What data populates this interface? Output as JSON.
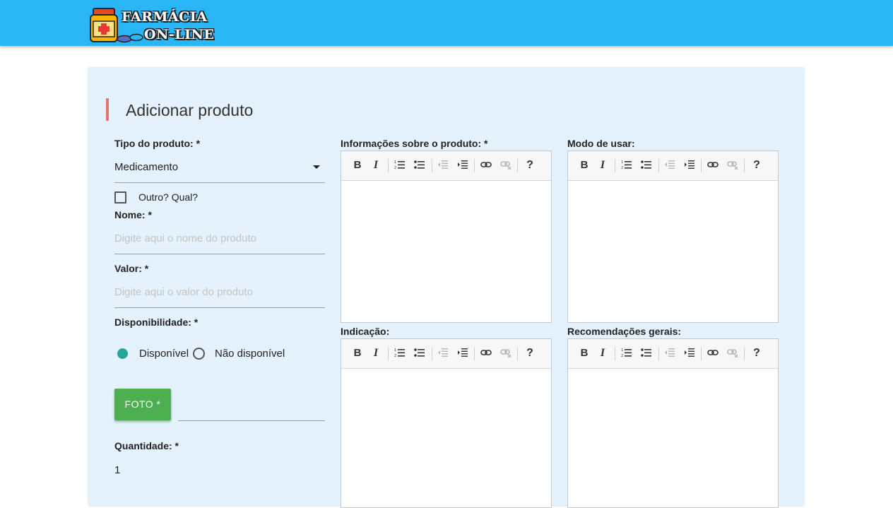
{
  "navbar": {
    "logo_line1": "FARMÁCIA",
    "logo_line2": "ON-LINE",
    "color": "#29b6f6"
  },
  "form": {
    "title": "Adicionar produto",
    "tipo": {
      "label": "Tipo do produto: *",
      "value": "Medicamento"
    },
    "outro": {
      "label": "Outro? Qual?",
      "checked": false
    },
    "nome": {
      "label": "Nome: *",
      "placeholder": "Digite aqui o nome do produto"
    },
    "valor": {
      "label": "Valor: *",
      "placeholder": "Digite aqui o valor do produto"
    },
    "disponibilidade": {
      "label": "Disponibilidade: *",
      "options": [
        {
          "label": "Disponível",
          "selected": true
        },
        {
          "label": "Não disponível",
          "selected": false
        }
      ]
    },
    "foto": {
      "button_label": "FOTO *"
    },
    "quantidade": {
      "label": "Quantidade: *",
      "value": "1"
    }
  },
  "editors": [
    {
      "label": "Informações sobre o produto: *"
    },
    {
      "label": "Modo de usar:"
    },
    {
      "label": "Indicação:"
    },
    {
      "label": "Recomendações gerais:"
    }
  ],
  "toolbar": {
    "bold_label": "B",
    "italic_label": "I",
    "help_label": "?",
    "icons": [
      "bold-icon",
      "italic-icon",
      "ordered-list-icon",
      "unordered-list-icon",
      "outdent-icon",
      "indent-icon",
      "link-icon",
      "unlink-icon",
      "help-icon"
    ]
  },
  "colors": {
    "card_bg": "#e3f2fd",
    "accent_bar": "#e57373",
    "radio_selected": "#26a69a",
    "foto_button": "#4caf50"
  }
}
